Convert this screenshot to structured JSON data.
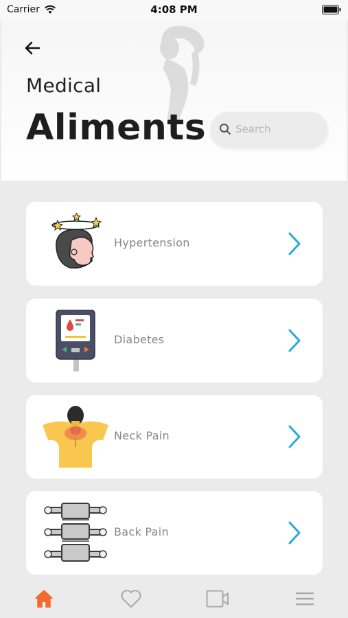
{
  "status_bar": {
    "carrier": "Carrier",
    "time": "4:08 PM"
  },
  "header": {
    "back_icon": "arrow-left-icon",
    "subtitle": "Medical",
    "title": "Aliments",
    "search": {
      "placeholder": "Search",
      "value": ""
    }
  },
  "ailments": [
    {
      "label": "Hypertension",
      "icon": "dizzy-head-icon"
    },
    {
      "label": "Diabetes",
      "icon": "glucose-meter-icon"
    },
    {
      "label": "Neck Pain",
      "icon": "neck-pain-icon"
    },
    {
      "label": "Back Pain",
      "icon": "spine-icon"
    }
  ],
  "tabbar": {
    "items": [
      {
        "icon": "home-icon",
        "active": true
      },
      {
        "icon": "heart-icon",
        "active": false
      },
      {
        "icon": "video-icon",
        "active": false
      },
      {
        "icon": "menu-icon",
        "active": false
      }
    ]
  },
  "colors": {
    "accent": "#f26a2e",
    "chevron": "#29a8e0",
    "inactive_icon": "#a8a8a8"
  }
}
